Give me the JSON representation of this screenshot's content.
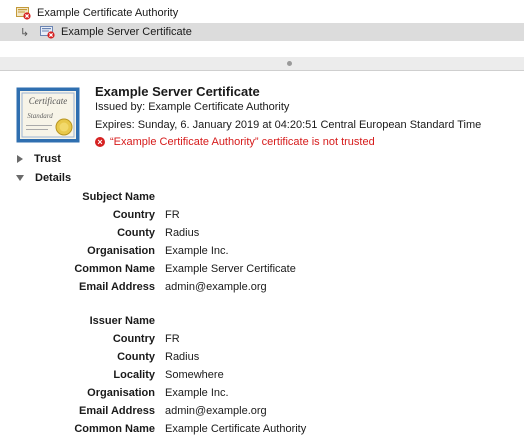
{
  "chain": {
    "items": [
      {
        "label": "Example Certificate Authority"
      },
      {
        "label": "Example Server Certificate"
      }
    ]
  },
  "certificate": {
    "title": "Example Server Certificate",
    "issued_by": "Issued by: Example Certificate Authority",
    "expires": "Expires: Sunday, 6. January 2019 at 04:20:51 Central European Standard Time",
    "trust_error": "“Example Certificate Authority” certificate is not trusted",
    "thumbnail_text_1": "Certificate",
    "thumbnail_text_2": "Standard"
  },
  "sections": {
    "trust": "Trust",
    "details": "Details"
  },
  "subject": {
    "heading": "Subject Name",
    "fields": [
      {
        "label": "Country",
        "value": "FR"
      },
      {
        "label": "County",
        "value": "Radius"
      },
      {
        "label": "Organisation",
        "value": "Example Inc."
      },
      {
        "label": "Common Name",
        "value": "Example Server Certificate"
      },
      {
        "label": "Email Address",
        "value": "admin@example.org"
      }
    ]
  },
  "issuer": {
    "heading": "Issuer Name",
    "fields": [
      {
        "label": "Country",
        "value": "FR"
      },
      {
        "label": "County",
        "value": "Radius"
      },
      {
        "label": "Locality",
        "value": "Somewhere"
      },
      {
        "label": "Organisation",
        "value": "Example Inc."
      },
      {
        "label": "Email Address",
        "value": "admin@example.org"
      },
      {
        "label": "Common Name",
        "value": "Example Certificate Authority"
      }
    ]
  },
  "colors": {
    "error": "#d61a1a",
    "selection": "#dcdcdc"
  }
}
